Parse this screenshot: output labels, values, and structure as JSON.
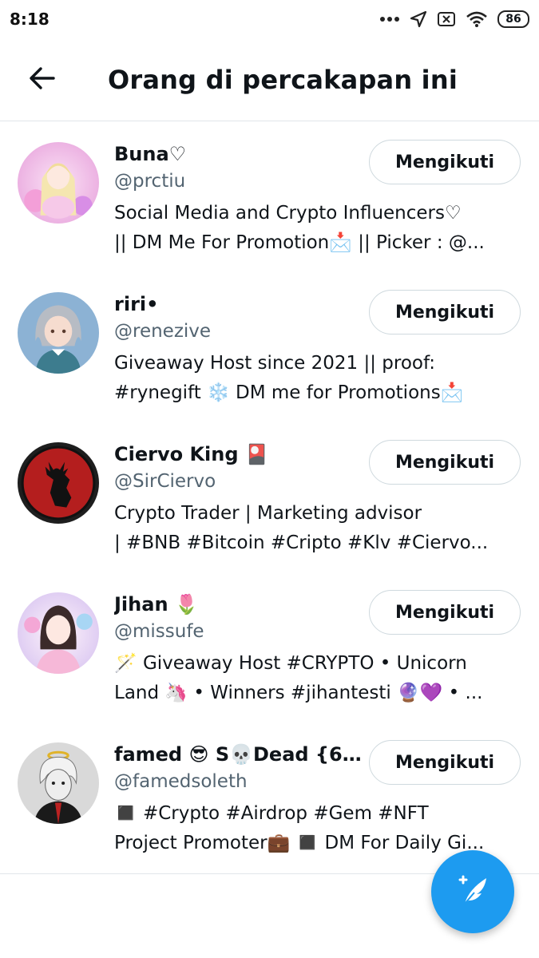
{
  "status_bar": {
    "time": "8:18",
    "battery": "86",
    "icons": [
      "dots-icon",
      "location-arrow-icon",
      "sim-off-icon",
      "wifi-icon",
      "battery-icon"
    ]
  },
  "header": {
    "title": "Orang di percakapan ini",
    "back_icon": "arrow-left-icon"
  },
  "users": [
    {
      "name": "Buna♡",
      "handle": "@prctiu",
      "bio_line1": "Social Media and Crypto Influencers♡",
      "bio_line2": "|| DM Me For Promotion📩 || Picker : @...",
      "follow_label": "Mengikuti"
    },
    {
      "name": "riri•",
      "handle": "@renezive",
      "bio_line1": "Giveaway Host since 2021 || proof:",
      "bio_line2": "#rynegift ❄️ DM me for Promotions📩",
      "follow_label": "Mengikuti"
    },
    {
      "name": "Ciervo King 🎴",
      "handle": "@SirCiervo",
      "bio_line1": "Crypto Trader | Marketing advisor",
      "bio_line2": "| #BNB #Bitcoin #Cripto #Klv #Ciervo...",
      "follow_label": "Mengikuti"
    },
    {
      "name": "Jihan 🌷",
      "handle": "@missufe",
      "bio_line1": "🪄 Giveaway Host #CRYPTO • Unicorn",
      "bio_line2": "Land 🦄 • Winners #jihantesti 🔮💜 • ...",
      "follow_label": "Mengikuti"
    },
    {
      "name": "famed 😎 S💀Dead {6...",
      "handle": "@famedsoleth",
      "bio_line1": "◼️ #Crypto #Airdrop #Gem #NFT",
      "bio_line2": "Project Promoter💼 ◼️ DM For Daily Gi...",
      "follow_label": "Mengikuti"
    }
  ],
  "fab": {
    "icon": "compose-tweet-icon",
    "color": "#1d9bf0"
  },
  "colors": {
    "accent": "#1d9bf0",
    "secondary_text": "#536471",
    "border": "#cfd9de"
  }
}
